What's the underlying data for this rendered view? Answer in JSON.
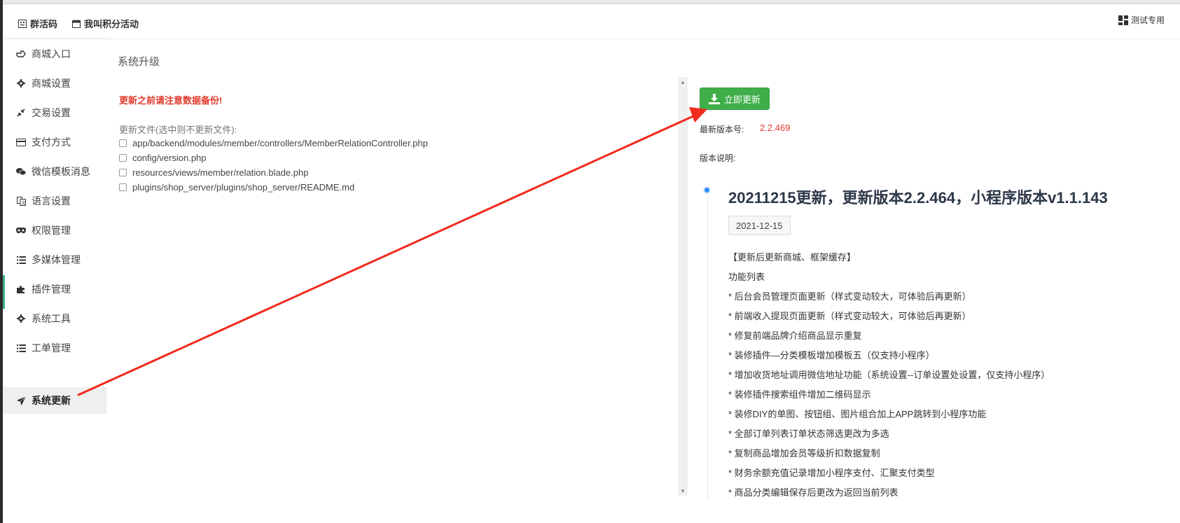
{
  "header": {
    "group_qr": "群活码",
    "points_activity": "我叫积分活动",
    "right_label": "测试专用"
  },
  "sidebar": {
    "items": [
      {
        "label": "商城入口",
        "icon": "hand-pointer-icon"
      },
      {
        "label": "商城设置",
        "icon": "gear-icon"
      },
      {
        "label": "交易设置",
        "icon": "compress-icon"
      },
      {
        "label": "支付方式",
        "icon": "credit-card-icon"
      },
      {
        "label": "微信模板消息",
        "icon": "wechat-icon"
      },
      {
        "label": "语言设置",
        "icon": "language-icon"
      },
      {
        "label": "权限管理",
        "icon": "eye-mask-icon"
      },
      {
        "label": "多媒体管理",
        "icon": "list-icon"
      },
      {
        "label": "插件管理",
        "icon": "puzzle-icon"
      },
      {
        "label": "系统工具",
        "icon": "gear-icon"
      },
      {
        "label": "工单管理",
        "icon": "list-icon"
      },
      {
        "label": "系统更新",
        "icon": "paper-plane-icon",
        "active": true
      }
    ]
  },
  "main": {
    "page_title": "系统升级",
    "warning": "更新之前请注意数据备份!",
    "files_label": "更新文件(选中则不更新文件):",
    "files": [
      "app/backend/modules/member/controllers/MemberRelationController.php",
      "config/version.php",
      "resources/views/member/relation.blade.php",
      "plugins/shop_server/plugins/shop_server/README.md"
    ]
  },
  "update": {
    "button_label": "立即更新",
    "latest_version_label": "最新版本号:",
    "latest_version": "2.2.469",
    "notes_label": "版本说明:",
    "release_title": "20211215更新，更新版本2.2.464，小程序版本v1.1.143",
    "release_date": "2021-12-15",
    "notes": [
      "【更新后更新商城、框架缓存】",
      "功能列表",
      "* 后台会员管理页面更新（样式变动较大，可体验后再更新）",
      "* 前端收入提现页面更新（样式变动较大，可体验后再更新）",
      "* 修复前端品牌介绍商品显示重复",
      "* 装修插件—分类模板增加模板五（仅支持小程序）",
      "* 增加收货地址调用微信地址功能（系统设置--订单设置处设置，仅支持小程序）",
      "* 装修插件搜索组件增加二维码显示",
      "* 装修DIY的单图、按钮组、图片组合加上APP跳转到小程序功能",
      "* 全部订单列表订单状态筛选更改为多选",
      "* 复制商品增加会员等级折扣数据复制",
      "* 财务余额充值记录增加小程序支付、汇聚支付类型",
      "* 商品分类编辑保存后更改为返回当前列表"
    ]
  },
  "colors": {
    "accent_green": "#3fae49",
    "warning_red": "#e0392b",
    "arrow_red": "#f02a1e",
    "timeline_blue": "#2f8ef3"
  }
}
